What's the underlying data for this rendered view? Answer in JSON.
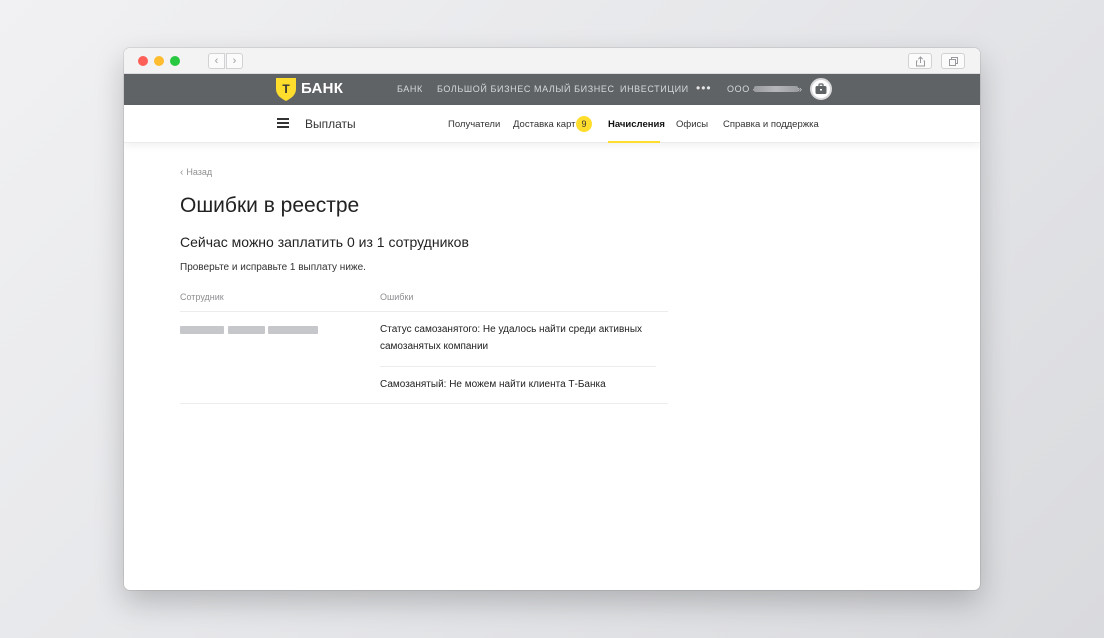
{
  "browser": {
    "back_glyph": "‹",
    "forward_glyph": "›"
  },
  "topbar": {
    "logo_letter": "Т",
    "logo_text": "БАНК",
    "nav": [
      "БАНК",
      "БОЛЬШОЙ БИЗНЕС",
      "МАЛЫЙ БИЗНЕС",
      "ИНВЕСТИЦИИ"
    ],
    "more": "•••",
    "org_prefix": "ООО «",
    "org_suffix": "»"
  },
  "subnav": {
    "section_title": "Выплаты",
    "items": [
      "Получатели",
      "Доставка карт",
      "Начисления",
      "Офисы",
      "Справка и поддержка"
    ],
    "active_item": "Начисления",
    "delivery_badge": "9"
  },
  "page": {
    "back_label": "Назад",
    "title": "Ошибки в реестре",
    "subtitle": "Сейчас можно заплатить 0 из 1 сотрудников",
    "hint": "Проверьте и исправьте 1 выплату ниже."
  },
  "table": {
    "headers": [
      "Сотрудник",
      "Ошибки"
    ],
    "errors": [
      "Статус самозанятого: Не удалось найти среди активных самозанятых компании",
      "Самозанятый: Не можем найти клиента Т-Банка"
    ]
  },
  "colors": {
    "brand_yellow": "#ffdd2d",
    "topbar_bg": "#5f6366"
  }
}
